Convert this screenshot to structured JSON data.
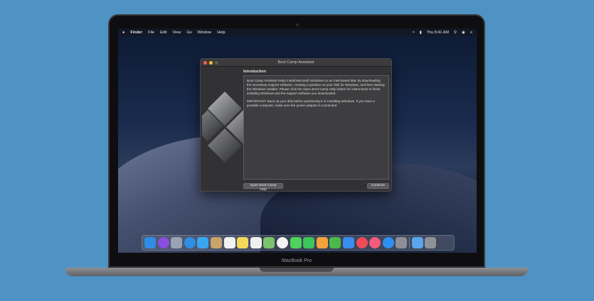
{
  "menubar": {
    "finder": "Finder",
    "items": [
      "File",
      "Edit",
      "View",
      "Go",
      "Window",
      "Help"
    ],
    "clock": "Thu 8:41 AM"
  },
  "window": {
    "title": "Boot Camp Assistant",
    "heading": "Introduction",
    "paragraph1": "Boot Camp Assistant helps install Microsoft Windows on an Intel-based Mac by downloading the necessary support software, creating a partition on your disk for Windows, and then starting the Windows installer. Please click the Open Boot Camp Help button for instructions to finish installing Windows and the support software you downloaded.",
    "paragraph2": "IMPORTANT: Back up your disk before partitioning it or installing Windows. If you have a portable computer, make sure the power adaptor is connected.",
    "help_button": "Open Boot Camp Help",
    "continue_button": "Continue"
  },
  "dock": {
    "apps": [
      {
        "name": "finder-icon",
        "color": "#2f8de4"
      },
      {
        "name": "siri-icon",
        "color": "#8a4de0"
      },
      {
        "name": "launchpad-icon",
        "color": "#9aa3b5"
      },
      {
        "name": "safari-icon",
        "color": "#2e8fe6"
      },
      {
        "name": "mail-icon",
        "color": "#3aa5f0"
      },
      {
        "name": "contacts-icon",
        "color": "#c8a36a"
      },
      {
        "name": "calendar-icon",
        "color": "#f2f2f2"
      },
      {
        "name": "notes-icon",
        "color": "#f5d75a"
      },
      {
        "name": "reminders-icon",
        "color": "#f0f0f0"
      },
      {
        "name": "maps-icon",
        "color": "#7cc36b"
      },
      {
        "name": "photos-icon",
        "color": "#f3f3f3"
      },
      {
        "name": "messages-icon",
        "color": "#4fd35c"
      },
      {
        "name": "facetime-icon",
        "color": "#3ec45a"
      },
      {
        "name": "pages-icon",
        "color": "#f2a33a"
      },
      {
        "name": "numbers-icon",
        "color": "#4cb84a"
      },
      {
        "name": "keynote-icon",
        "color": "#3a8ef0"
      },
      {
        "name": "news-icon",
        "color": "#f04a5a"
      },
      {
        "name": "music-icon",
        "color": "#f45b7a"
      },
      {
        "name": "app-store-icon",
        "color": "#2f8ff0"
      },
      {
        "name": "system-preferences-icon",
        "color": "#8d8f96"
      }
    ],
    "extras": [
      {
        "name": "downloads-folder-icon",
        "color": "#5aa6e8"
      },
      {
        "name": "trash-icon",
        "color": "#8e9197"
      }
    ]
  },
  "brand": "MacBook Pro"
}
